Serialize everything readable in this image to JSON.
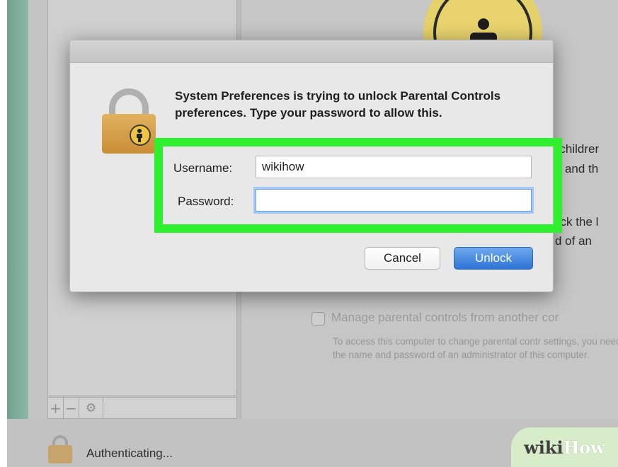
{
  "background": {
    "content_fragments": [
      "r childrer",
      "it, and th",
      "lick the l",
      "d of an"
    ],
    "manage_remote_label": "Manage parental controls from another cor",
    "manage_remote_description": "To access this computer to change parental contr settings, you need the name and password of an administrator of this computer.",
    "list_controls": [
      "+",
      "−",
      "⚙"
    ],
    "status_text": "Authenticating..."
  },
  "dialog": {
    "message": "System Preferences is trying to unlock Parental Controls preferences. Type your password to allow this.",
    "username_label": "Username:",
    "username_value": "wikihow",
    "password_label": "Password:",
    "password_value": "",
    "cancel_label": "Cancel",
    "unlock_label": "Unlock"
  },
  "watermark": {
    "part1": "wiki",
    "part2": "How"
  },
  "colors": {
    "highlight": "#2ef02e",
    "unlock_button": "#2d74d6",
    "lock_body": "#d9a04a"
  },
  "icons": [
    "lock-icon",
    "parental-badge-icon",
    "add-icon",
    "remove-icon",
    "gear-icon",
    "small-lock-icon"
  ]
}
